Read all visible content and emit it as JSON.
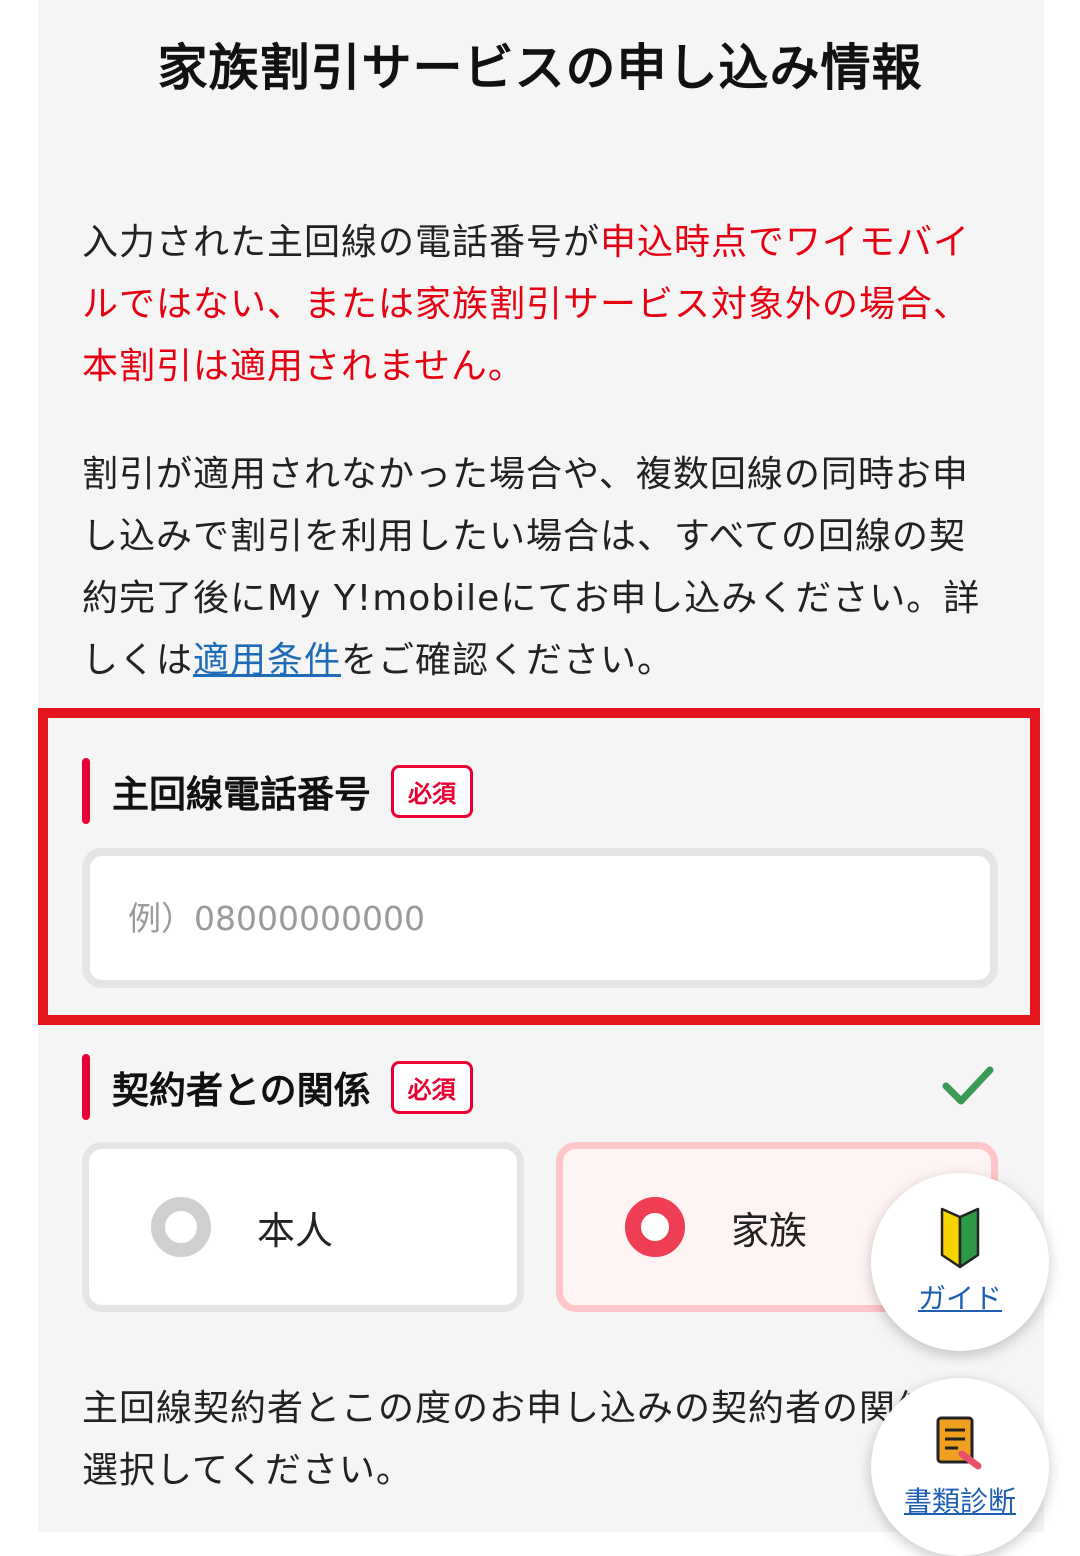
{
  "title": "家族割引サービスの申し込み情報",
  "notice": {
    "part1": "入力された主回線の電話番号が",
    "part2_red": "申込時点でワイモバイルではない、または家族割引サービス対象外の場合、本割引は適用されません。"
  },
  "info": {
    "text_before_link": "割引が適用されなかった場合や、複数回線の同時お申し込みで割引を利用したい場合は、すべての回線の契約完了後にMy Y!mobileにてお申し込みください。詳しくは",
    "link_text": "適用条件",
    "text_after_link": "をご確認ください。"
  },
  "phone_field": {
    "label": "主回線電話番号",
    "badge": "必須",
    "placeholder": "例）08000000000",
    "value": ""
  },
  "relation_field": {
    "label": "契約者との関係",
    "badge": "必須",
    "status_icon": "check-icon",
    "options": [
      {
        "label": "本人",
        "selected": false
      },
      {
        "label": "家族",
        "selected": true
      }
    ]
  },
  "bottom_text": "主回線契約者とこの度のお申し込みの契約者の関係を選択してください。",
  "floating": {
    "guide_label": "ガイド",
    "docs_label": "書類診断"
  },
  "colors": {
    "accent_red": "#e60012",
    "highlight_border": "#e4151c",
    "link_blue": "#1e6bb8",
    "check_green": "#3a9b57"
  }
}
